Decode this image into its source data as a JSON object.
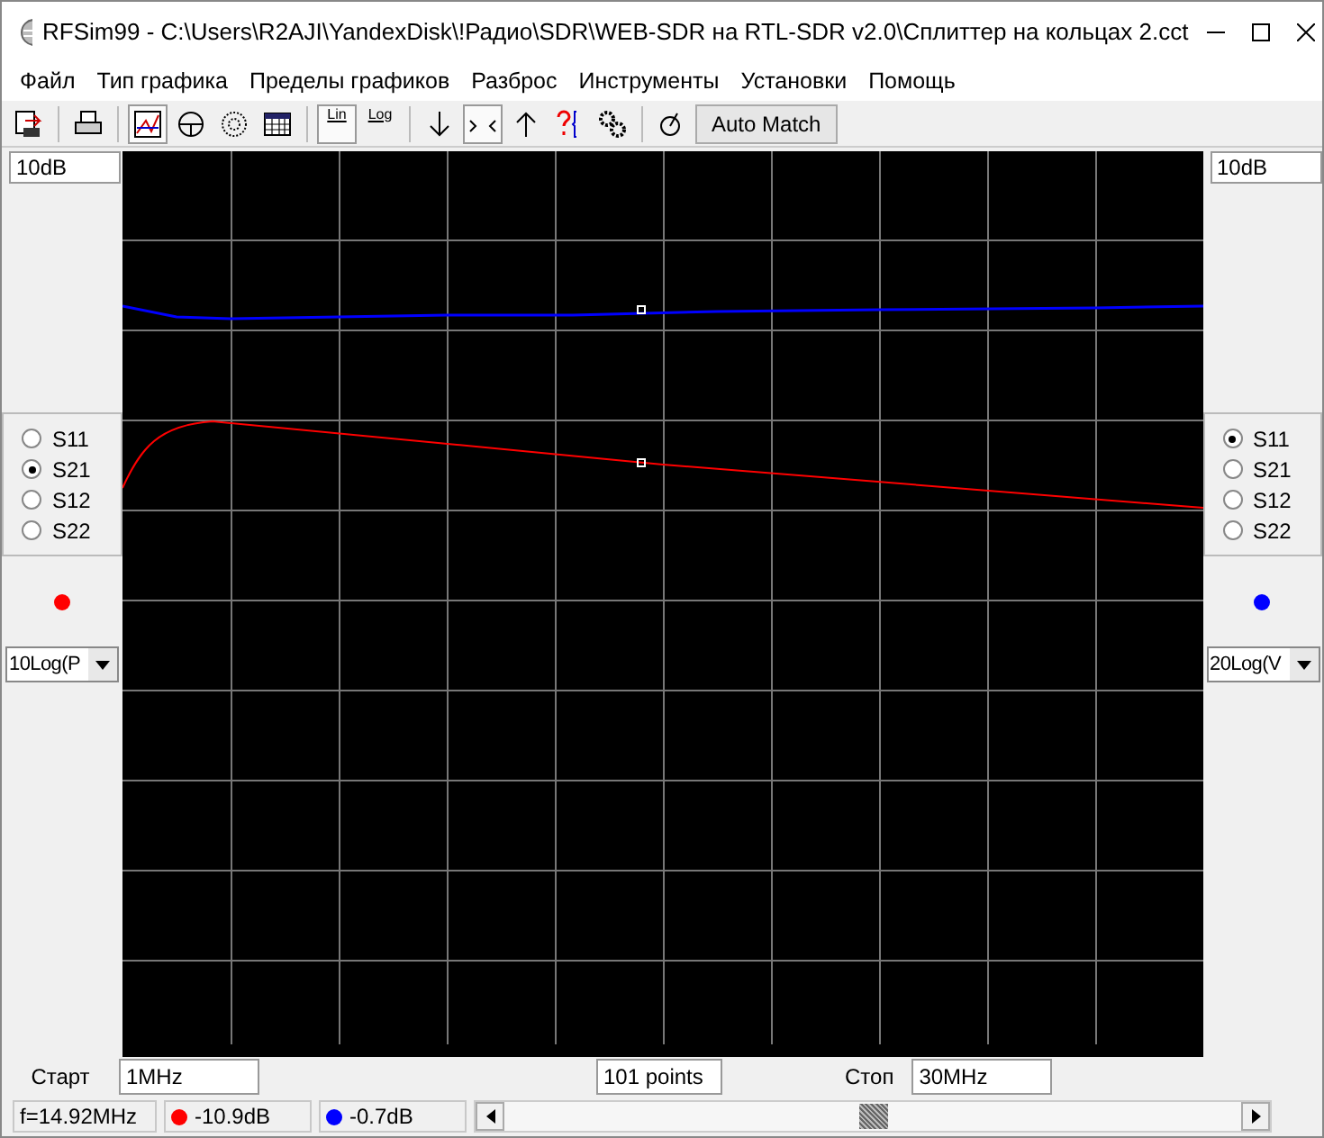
{
  "window": {
    "title": "RFSim99 - C:\\Users\\R2AJI\\YandexDisk\\!Радио\\SDR\\WEB-SDR на RTL-SDR v2.0\\Сплиттер на кольцах 2.cct"
  },
  "menu": [
    "Файл",
    "Тип графика",
    "Пределы графиков",
    "Разброс",
    "Инструменты",
    "Установки",
    "Помощь"
  ],
  "toolbar": [
    {
      "pressed": false
    },
    {
      "pressed": false
    },
    {
      "pressed": true
    },
    {
      "pressed": false
    },
    {
      "pressed": false
    },
    {
      "pressed": false
    },
    {
      "label": "Lin",
      "pressed": true
    },
    {
      "label": "Log",
      "pressed": false
    },
    {
      "pressed": false
    },
    {
      "pressed": true
    },
    {
      "pressed": false
    },
    {
      "pressed": false
    },
    {
      "pressed": false
    },
    {
      "pressed": false
    },
    {
      "label": "Auto Match",
      "pressed": false
    }
  ],
  "left_panel": {
    "scale": "10dB",
    "params": [
      {
        "label": "S11",
        "selected": false
      },
      {
        "label": "S21",
        "selected": true
      },
      {
        "label": "S12",
        "selected": false
      },
      {
        "label": "S22",
        "selected": false
      }
    ],
    "color": "#ff0000",
    "unit": "10Log(P"
  },
  "right_panel": {
    "scale": "10dB",
    "params": [
      {
        "label": "S11",
        "selected": true
      },
      {
        "label": "S21",
        "selected": false
      },
      {
        "label": "S12",
        "selected": false
      },
      {
        "label": "S22",
        "selected": false
      }
    ],
    "color": "#0000ff",
    "unit": "20Log(V"
  },
  "sweep": {
    "start_label": "Старт",
    "start": "1MHz",
    "points": "101 points",
    "stop_label": "Стоп",
    "stop": "30MHz"
  },
  "status": {
    "frequency": "f=14.92MHz",
    "readings": [
      {
        "color": "#ff0000",
        "value": "-10.9dB"
      },
      {
        "color": "#0000ff",
        "value": "-0.7dB"
      }
    ]
  }
}
